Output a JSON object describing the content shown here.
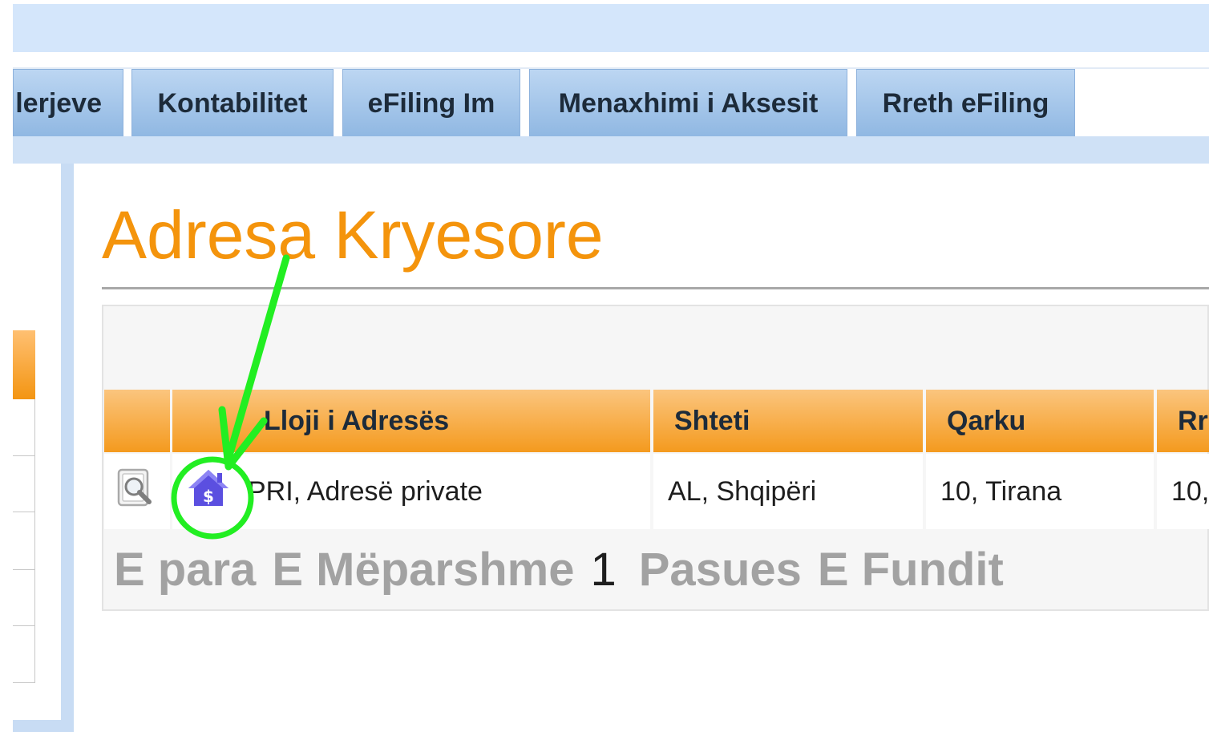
{
  "nav": {
    "tabs": [
      {
        "label": "lerjeve"
      },
      {
        "label": "Kontabilitet"
      },
      {
        "label": "eFiling Im"
      },
      {
        "label": "Menaxhimi i Aksesit"
      },
      {
        "label": "Rreth eFiling"
      }
    ]
  },
  "page": {
    "title": "Adresa Kryesore"
  },
  "table": {
    "columns": [
      "",
      "Lloji i Adresës",
      "Shteti",
      "Qarku",
      "Rr"
    ],
    "rows": [
      {
        "type": "PRI, Adresë private",
        "country": "AL, Shqipëri",
        "district": "10, Tirana",
        "next": "10,"
      }
    ]
  },
  "pager": {
    "first": "E para",
    "previous": "E Mëparshme",
    "current": "1",
    "next": "Pasues",
    "last": "E Fundit"
  },
  "icons": {
    "view": "magnifier-document-icon",
    "address_type": "house-dollar-icon"
  },
  "colors": {
    "title": "#f4940c",
    "header_orange": "#f49a1e",
    "nav_blue": "#8fb7e2",
    "annotation": "#22ee22",
    "house_icon": "#5b4fe0"
  }
}
